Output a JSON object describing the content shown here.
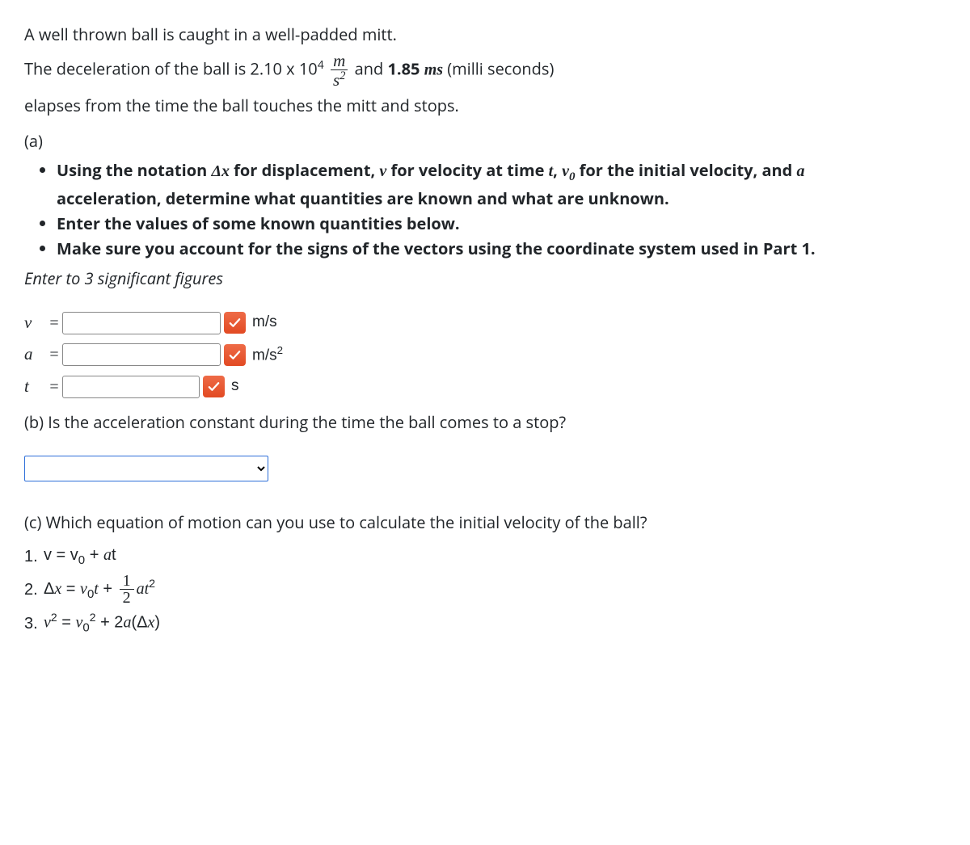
{
  "intro": {
    "line1": "A well thrown ball is caught in a well-padded mitt.",
    "line2_pre": "The deceleration of the ball is 2.10 x 10",
    "line2_exp": "4",
    "frac_num": "m",
    "frac_den_base": "s",
    "frac_den_exp": "2",
    "line2_mid": " and ",
    "line2_time_val": "1.85 ",
    "line2_time_unit": "ms",
    "line2_post": " (milli seconds)",
    "line3": "elapses from the time the ball touches the mitt and stops."
  },
  "partA": {
    "label": "(a)",
    "bullet1_pre": "Using the notation ",
    "bullet1_dx": "Δx",
    "bullet1_mid1": " for displacement, ",
    "bullet1_v": "v",
    "bullet1_mid2": " for velocity at time ",
    "bullet1_t": "t",
    "bullet1_mid3": ", ",
    "bullet1_v0_base": "v",
    "bullet1_v0_sub": "0",
    "bullet1_mid4": " for the initial velocity,  and ",
    "bullet1_a": "a",
    "bullet1_end": " acceleration, determine what quantities are known and what are unknown.",
    "bullet2": "Enter the values of some known quantities below.",
    "bullet3": "Make sure you account for the signs of  the vectors using the coordinate system used in Part 1.",
    "sigfig": "Enter to 3 significant figures",
    "fields": {
      "v": {
        "label": "v",
        "value": "",
        "unit_html": "m/s"
      },
      "a": {
        "label": "a",
        "value": "",
        "unit_base": "m/s",
        "unit_exp": "2"
      },
      "t": {
        "label": "t",
        "value": "",
        "unit_html": "s"
      }
    }
  },
  "partB": {
    "prompt": "(b) Is the acceleration constant during the time the ball comes to a stop?",
    "selected": ""
  },
  "partC": {
    "prompt": "(c)  Which equation of motion can you use to calculate the initial velocity of the ball?",
    "eq1_num": "1.",
    "eq2_num": "2.",
    "eq3_num": "3."
  }
}
